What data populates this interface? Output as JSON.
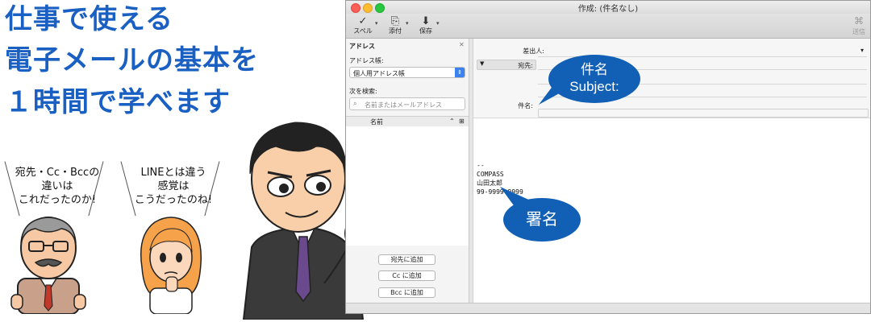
{
  "headline": {
    "line1": "仕事で使える",
    "line2": "電子メールの基本を",
    "line3": "１時間で学べます"
  },
  "bubbles": {
    "left": {
      "line1": "宛先・Cc・Bccの",
      "line2": "違いは",
      "line3": "これだったのか!"
    },
    "right": {
      "line1": "LINEとは違う",
      "line2": "感覚は",
      "line3": "こうだったのね!"
    }
  },
  "window": {
    "title": "作成: (件名なし)",
    "toolbar": {
      "spell": "スペル",
      "attach": "添付",
      "save": "保存",
      "send": "送信"
    },
    "address_panel": {
      "title": "アドレス",
      "book_label": "アドレス帳:",
      "book_value": "個人用アドレス帳",
      "search_label": "次を検索:",
      "search_placeholder": "名前またはメールアドレス",
      "column_name": "名前",
      "add_to": "宛先に追加",
      "add_cc": "Cc に追加",
      "add_bcc": "Bcc に追加"
    },
    "compose": {
      "from_label": "差出人:",
      "to_label": "宛先:",
      "subject_label": "件名:",
      "signature": {
        "sep": "--",
        "line1": "COMPASS",
        "line2": "山田太郎",
        "line3": "99-9999-9999"
      }
    }
  },
  "callouts": {
    "subject_jp": "件名",
    "subject_en": "Subject:",
    "signature": "署名"
  },
  "colors": {
    "headline": "#1a5fc2",
    "callout": "#1160b6"
  }
}
